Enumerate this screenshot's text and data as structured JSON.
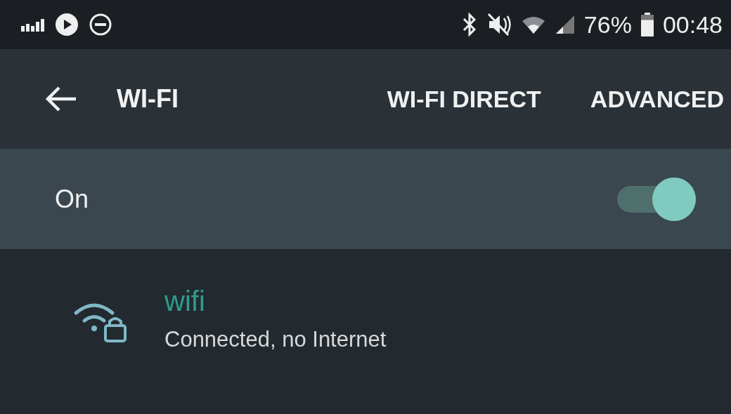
{
  "status_bar": {
    "battery": {
      "text": "76%",
      "level": 0.76
    },
    "time": "00:48"
  },
  "toolbar": {
    "title": "WI-FI",
    "actions": [
      "WI-FI DIRECT",
      "ADVANCED"
    ]
  },
  "master_switch": {
    "label": "On",
    "on": true
  },
  "networks": [
    {
      "name": "wifi",
      "status": "Connected, no Internet",
      "connected": true
    }
  ]
}
